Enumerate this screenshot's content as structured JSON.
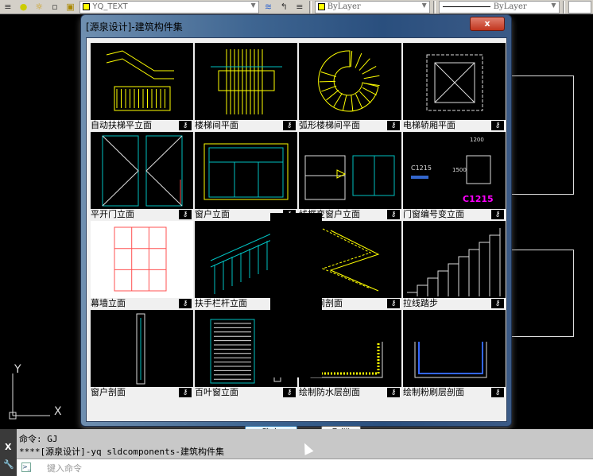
{
  "toolbar": {
    "layer_name": "YQ_TEXT",
    "color": "ByLayer",
    "linetype": "ByLayer",
    "icons": [
      "layer-match-icon",
      "bulb-icon",
      "sun-icon",
      "freeze-icon",
      "lock-icon",
      "layer-states-icon",
      "layer-previous-icon",
      "layer-properties-icon"
    ]
  },
  "dialog": {
    "title": "[源泉设计]-建筑构件集",
    "close_label": "x",
    "ok_label": "确定",
    "cancel_label": "取消",
    "items": [
      {
        "label": "自动扶梯平立面"
      },
      {
        "label": "楼梯间平面"
      },
      {
        "label": "弧形楼梯间平面"
      },
      {
        "label": "电梯轿厢平面"
      },
      {
        "label": "平开门立面"
      },
      {
        "label": "窗户立面"
      },
      {
        "label": "线框变窗户立面"
      },
      {
        "label": "门窗编号变立面",
        "thumb_text": [
          "C1215",
          "1200",
          "1500",
          "C1215"
        ]
      },
      {
        "label": "幕墙立面"
      },
      {
        "label": "扶手栏杆立面"
      },
      {
        "label": "楼梯间剖面"
      },
      {
        "label": "拉线踏步"
      },
      {
        "label": "窗户剖面"
      },
      {
        "label": "百叶窗立面"
      },
      {
        "label": "绘制防水层剖面"
      },
      {
        "label": "绘制粉刷层剖面"
      }
    ]
  },
  "ucs": {
    "x_label": "X",
    "y_label": "Y"
  },
  "command": {
    "history": [
      "命令: GJ",
      "****[源泉设计]-yq sldcomponents-建筑构件集"
    ],
    "placeholder": "键入命令",
    "close_label": "X"
  },
  "colors": {
    "cad_background": "#000000",
    "yellow": "#ffff00",
    "cyan": "#00c0c0",
    "magenta": "#ff00ff",
    "red": "#ff4040"
  }
}
